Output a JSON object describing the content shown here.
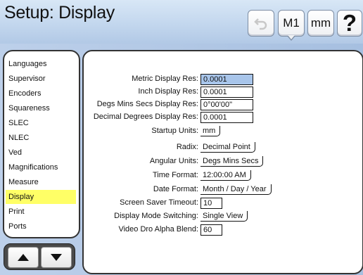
{
  "header": {
    "title": "Setup: Display",
    "m1_label": "M1",
    "units_label": "mm",
    "help_label": "?",
    "undo_icon": "undo-icon"
  },
  "sidebar": {
    "items": [
      {
        "label": "Languages"
      },
      {
        "label": "Supervisor"
      },
      {
        "label": "Encoders"
      },
      {
        "label": "Squareness"
      },
      {
        "label": "SLEC"
      },
      {
        "label": "NLEC"
      },
      {
        "label": "Ved"
      },
      {
        "label": "Magnifications"
      },
      {
        "label": "Measure"
      },
      {
        "label": "Display"
      },
      {
        "label": "Print"
      },
      {
        "label": "Ports"
      }
    ],
    "selected": "Display"
  },
  "settings": {
    "metric_display_res": {
      "label": "Metric Display Res:",
      "value": "0.0001"
    },
    "inch_display_res": {
      "label": "Inch Display Res:",
      "value": "0.0001"
    },
    "dms_display_res": {
      "label": "Degs Mins Secs Display Res:",
      "value": "0°00'00\""
    },
    "decimal_degrees_res": {
      "label": "Decimal Degrees Display Res:",
      "value": "0.0001"
    },
    "startup_units": {
      "label": "Startup Units:",
      "value": "mm"
    },
    "radix": {
      "label": "Radix:",
      "value": "Decimal Point"
    },
    "angular_units": {
      "label": "Angular Units:",
      "value": "Degs Mins Secs"
    },
    "time_format": {
      "label": "Time Format:",
      "value": "12:00:00 AM"
    },
    "date_format": {
      "label": "Date Format:",
      "value": "Month / Day / Year"
    },
    "screen_saver_timeout": {
      "label": "Screen Saver Timeout:",
      "value": "10"
    },
    "display_mode_switching": {
      "label": "Display Mode Switching:",
      "value": "Single View"
    },
    "video_dro_alpha_blend": {
      "label": "Video Dro Alpha Blend:",
      "value": "60"
    }
  },
  "colors": {
    "header_bg": "#c3d7ee",
    "selected_item": "#ffff66",
    "highlight_field": "#a8c5ea"
  }
}
